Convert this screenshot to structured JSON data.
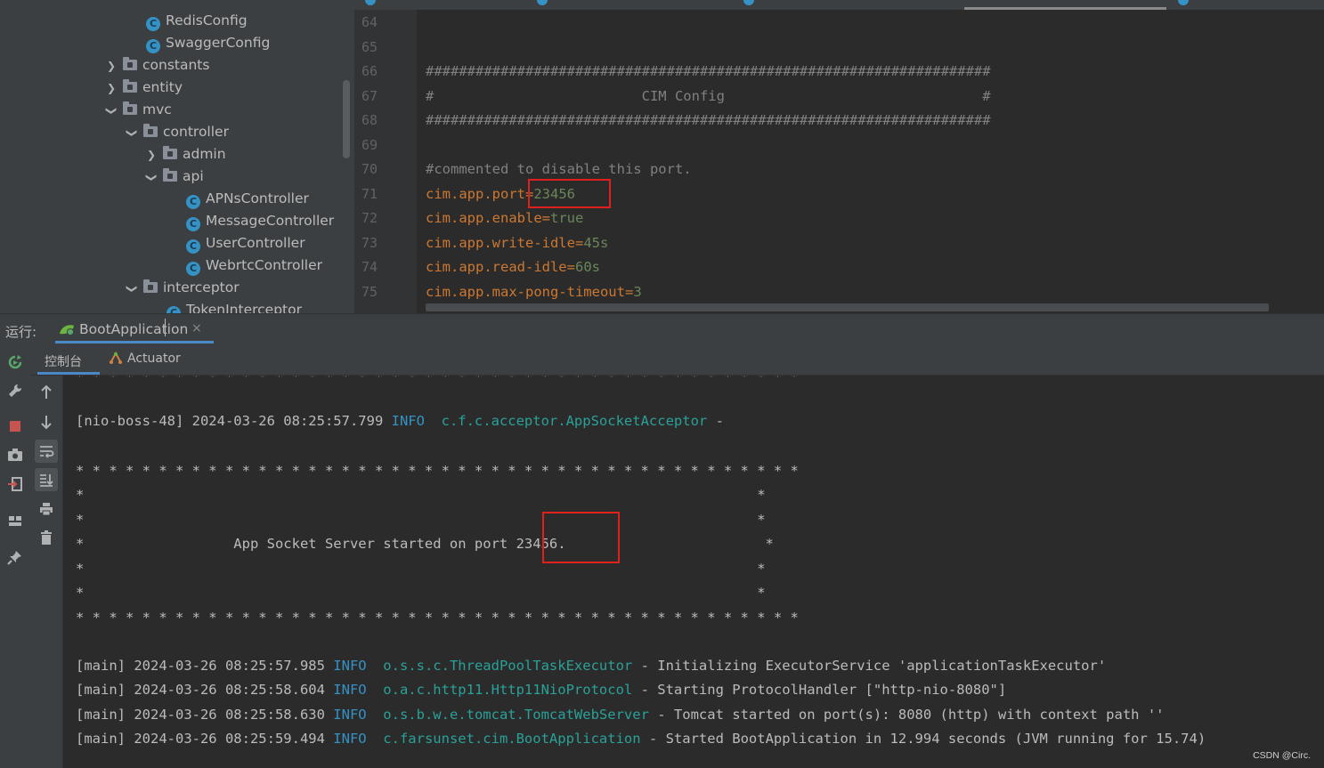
{
  "project_tree": {
    "items": [
      {
        "label": "RedisConfig",
        "kind": "class"
      },
      {
        "label": "SwaggerConfig",
        "kind": "class"
      },
      {
        "label": "constants",
        "kind": "folder",
        "expanded": false
      },
      {
        "label": "entity",
        "kind": "folder",
        "expanded": false
      },
      {
        "label": "mvc",
        "kind": "folder",
        "expanded": true
      },
      {
        "label": "controller",
        "kind": "folder",
        "expanded": true
      },
      {
        "label": "admin",
        "kind": "folder",
        "expanded": false
      },
      {
        "label": "api",
        "kind": "folder",
        "expanded": true
      },
      {
        "label": "APNsController",
        "kind": "class"
      },
      {
        "label": "MessageController",
        "kind": "class"
      },
      {
        "label": "UserController",
        "kind": "class"
      },
      {
        "label": "WebrtcController",
        "kind": "class"
      },
      {
        "label": "interceptor",
        "kind": "folder",
        "expanded": true
      },
      {
        "label": "TokenInterceptor",
        "kind": "class"
      }
    ],
    "class_icon_letter": "C"
  },
  "editor": {
    "line_numbers": [
      "64",
      "65",
      "66",
      "67",
      "68",
      "69",
      "70",
      "71",
      "72",
      "73",
      "74",
      "75"
    ],
    "lines": [
      {
        "text": ""
      },
      {
        "text": ""
      },
      {
        "text": "####################################################################"
      },
      {
        "text": "#                         CIM Config                               #"
      },
      {
        "text": "####################################################################"
      },
      {
        "text": ""
      },
      {
        "text": "#commented to disable this port."
      },
      {
        "key": "cim.app.port",
        "value": "23456"
      },
      {
        "key": "cim.app.enable",
        "value": "true"
      },
      {
        "key": "cim.app.write-idle",
        "value": "45s"
      },
      {
        "key": "cim.app.read-idle",
        "value": "60s"
      },
      {
        "key": "cim.app.max-pong-timeout",
        "value": "3"
      }
    ],
    "equals": "="
  },
  "run_window": {
    "label": "运行:",
    "tab_label": "BootApplication",
    "close_glyph": "×",
    "console_tab": "控制台",
    "actuator_tab": "Actuator"
  },
  "console": {
    "acceptor_line": {
      "prefix": "[nio-boss-48] 2024-03-26 08:25:57.799 ",
      "level": "INFO",
      "logger": "c.f.c.acceptor.AppSocketAcceptor",
      "suffix": " -"
    },
    "banner_border": "* * * * * * * * * * * * * * * * * * * * * * * * * * * * * * * * * * * * * * * * * * * *",
    "banner_empty": "*                                                                                 *",
    "banner_message": "*                  App Socket Server started on port 23456.                        *",
    "log_lines": [
      {
        "prefix": "[main] 2024-03-26 08:25:57.985 ",
        "level": "INFO",
        "logger": "o.s.s.c.ThreadPoolTaskExecutor",
        "suffix": " - Initializing ExecutorService 'applicationTaskExecutor'"
      },
      {
        "prefix": "[main] 2024-03-26 08:25:58.604 ",
        "level": "INFO",
        "logger": "o.a.c.http11.Http11NioProtocol",
        "suffix": " - Starting ProtocolHandler [\"http-nio-8080\"]"
      },
      {
        "prefix": "[main] 2024-03-26 08:25:58.630 ",
        "level": "INFO",
        "logger": "o.s.b.w.e.tomcat.TomcatWebServer",
        "suffix": " - Tomcat started on port(s): 8080 (http) with context path ''"
      },
      {
        "prefix": "[main] 2024-03-26 08:25:59.494 ",
        "level": "INFO",
        "logger": "c.farsunset.cim.BootApplication",
        "suffix": " - Started BootApplication in 12.994 seconds (JVM running for 15.74)"
      }
    ]
  },
  "watermark": "CSDN @Circ.",
  "colors": {
    "key": "#cc7832",
    "value": "#6a8759",
    "info": "#3592c4",
    "logger": "#2aa198",
    "highlight": "#e0201c"
  }
}
